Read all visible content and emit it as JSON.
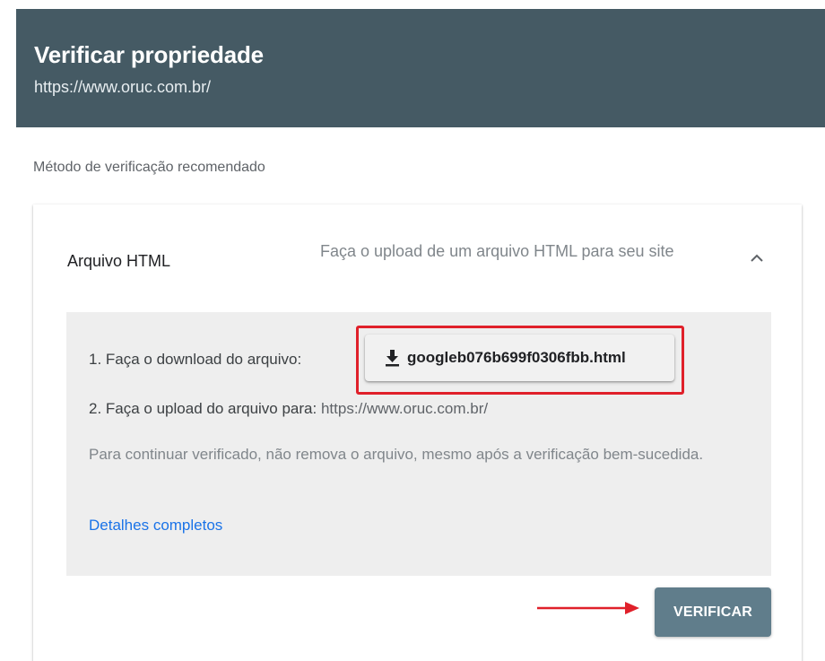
{
  "header": {
    "title": "Verificar propriedade",
    "url": "https://www.oruc.com.br/"
  },
  "method_label": "Método de verificação recomendado",
  "card": {
    "title": "Arquivo HTML",
    "description": "Faça o upload de um arquivo HTML para seu site",
    "collapse_icon": "chevron-up-icon"
  },
  "steps": {
    "step1_label": "1. Faça o download do arquivo:",
    "download_file": "googleb076b699f0306fbb.html",
    "download_icon": "download-icon",
    "step2_label": "2. Faça o upload do arquivo para:",
    "step2_url": "https://www.oruc.com.br/",
    "keep_note": "Para continuar verificado, não remova o arquivo, mesmo após a verificação bem-sucedida.",
    "details_link": "Detalhes completos"
  },
  "verify_button": "VERIFICAR",
  "colors": {
    "header_bg": "#455a64",
    "panel_bg": "#eeeeee",
    "link": "#1a73e8",
    "highlight": "#e0202a",
    "verify_bg": "#607d8b"
  }
}
